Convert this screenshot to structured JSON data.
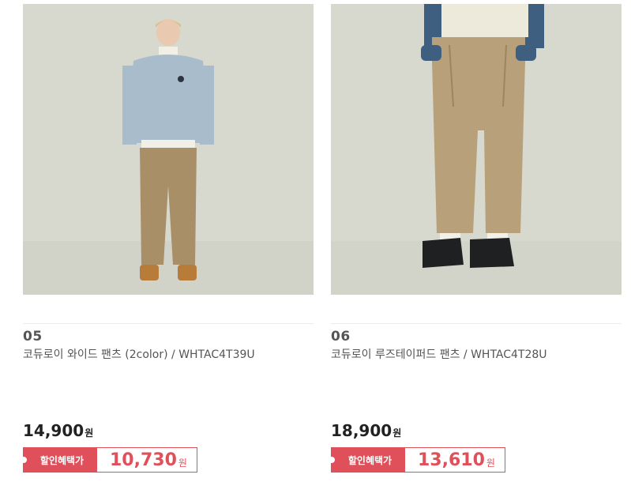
{
  "products": [
    {
      "number": "05",
      "name": "코듀로이 와이드 팬츠 (2color) / WHTAC4T39U",
      "price": "14,900",
      "currency": "원",
      "sale_label": "할인혜택가",
      "sale_price": "10,730",
      "image": "model-corduroy-wide-pants-full-body"
    },
    {
      "number": "06",
      "name": "코듀로이 루즈테이퍼드 팬츠 / WHTAC4T28U",
      "price": "18,900",
      "currency": "원",
      "sale_label": "할인혜택가",
      "sale_price": "13,610",
      "image": "model-corduroy-tapered-pants-lower-body"
    }
  ],
  "colors": {
    "accent": "#e0505a",
    "photo_bg": "#d8d9cf",
    "pants": "#a88f68"
  }
}
